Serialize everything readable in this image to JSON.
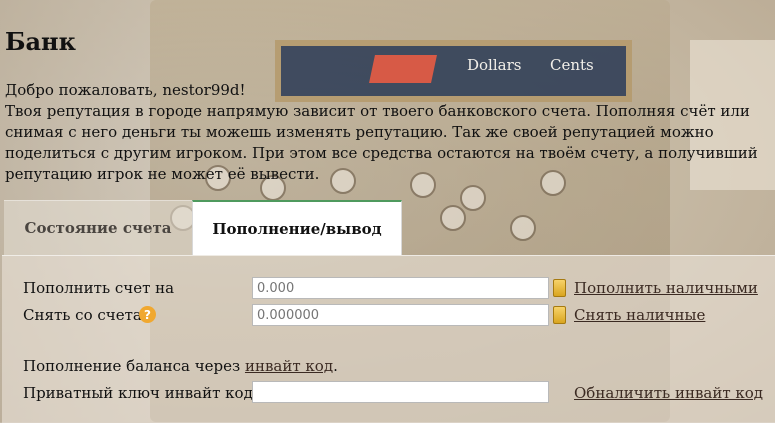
{
  "page": {
    "title": "Банк",
    "greeting": "Добро пожаловать, nestor99d!",
    "description": "Твоя репутация в городе напрямую зависит от твоего банковского счета. Пополняя счёт или снимая с него деньги ты можешь изменять репутацию. Так же своей репутацией можно поделиться с другим игроком. При этом все средства остаются на твоём счету, а получивший репутацию игрок не может её вывести."
  },
  "tabs": [
    {
      "label": "Состояние счета",
      "active": false
    },
    {
      "label": "Пополнение/вывод",
      "active": true
    }
  ],
  "deposit": {
    "label": "Пополнить счет на",
    "placeholder": "0.000",
    "currency_icon": "gold-coin-icon",
    "link": "Пополнить наличными"
  },
  "withdraw": {
    "label": "Снять со счета",
    "help_icon": "question-icon",
    "help_glyph": "?",
    "placeholder": "0.000000",
    "currency_icon": "gold-coin-icon",
    "link": "Снять наличные"
  },
  "invite": {
    "text_before": "Пополнение баланса через ",
    "link": "инвайт код",
    "text_after": ".",
    "key_label": "Приватный ключ инвайт кода",
    "key_value": "",
    "cash_link": "Обналичить инвайт код"
  },
  "background": {
    "dollars": "Dollars",
    "cents": "Cents"
  },
  "colors": {
    "active_tab_border": "#4f9a5e",
    "link": "#3b2a22",
    "coin": "#e0b030",
    "help": "#f0a830"
  }
}
